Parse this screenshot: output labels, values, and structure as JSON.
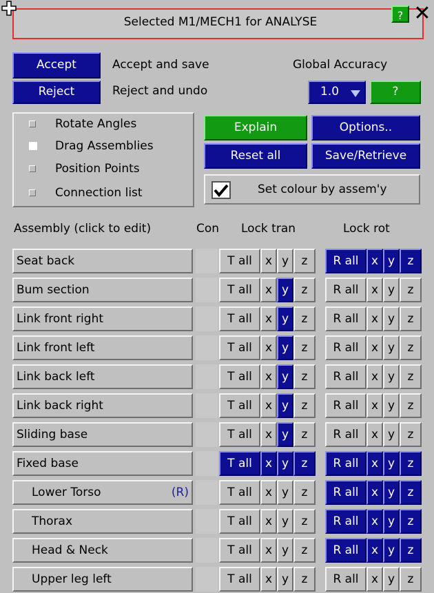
{
  "title": "Selected M1/MECH1 for ANALYSE",
  "help_label": "?",
  "close_label": "✕",
  "accept": {
    "button": "Accept",
    "desc": "Accept and save"
  },
  "reject": {
    "button": "Reject",
    "desc": "Reject and undo"
  },
  "accuracy": {
    "label": "Global Accuracy",
    "value": "1.0",
    "help": "?"
  },
  "options": [
    {
      "label": "Rotate Angles",
      "state": "off"
    },
    {
      "label": "Drag Assemblies",
      "state": "white"
    },
    {
      "label": "Position Points",
      "state": "off"
    },
    {
      "label": "Connection list",
      "state": "off"
    }
  ],
  "buttons": {
    "explain": "Explain",
    "options": "Options..",
    "reset": "Reset all",
    "save": "Save/Retrieve"
  },
  "colour": {
    "label": "Set colour by assem'y",
    "checked": true
  },
  "headers": {
    "assembly": "Assembly (click to edit)",
    "con": "Con",
    "lock_tran": "Lock tran",
    "lock_rot": "Lock rot"
  },
  "lock_labels": {
    "t_all": "T all",
    "r_all": "R all",
    "x": "x",
    "y": "y",
    "z": "z"
  },
  "colors": {
    "navy": "#0e0e92",
    "green": "#129a12",
    "panel": "#c0c0c0",
    "title_border": "#e03030"
  },
  "rows": [
    {
      "name": "Seat back",
      "flag": "",
      "sub": false,
      "tran": [
        false,
        false,
        false,
        false
      ],
      "rot": [
        true,
        true,
        true,
        true
      ]
    },
    {
      "name": "Bum section",
      "flag": "",
      "sub": false,
      "tran": [
        false,
        false,
        true,
        false
      ],
      "rot": [
        false,
        false,
        false,
        false
      ]
    },
    {
      "name": "Link front right",
      "flag": "",
      "sub": false,
      "tran": [
        false,
        false,
        true,
        false
      ],
      "rot": [
        false,
        false,
        false,
        false
      ]
    },
    {
      "name": "Link front left",
      "flag": "",
      "sub": false,
      "tran": [
        false,
        false,
        true,
        false
      ],
      "rot": [
        false,
        false,
        false,
        false
      ]
    },
    {
      "name": "Link back left",
      "flag": "",
      "sub": false,
      "tran": [
        false,
        false,
        true,
        false
      ],
      "rot": [
        false,
        false,
        false,
        false
      ]
    },
    {
      "name": "Link back right",
      "flag": "",
      "sub": false,
      "tran": [
        false,
        false,
        true,
        false
      ],
      "rot": [
        false,
        false,
        false,
        false
      ]
    },
    {
      "name": "Sliding base",
      "flag": "",
      "sub": false,
      "tran": [
        false,
        false,
        true,
        false
      ],
      "rot": [
        false,
        false,
        false,
        false
      ]
    },
    {
      "name": "Fixed base",
      "flag": "",
      "sub": false,
      "tran": [
        true,
        true,
        true,
        true
      ],
      "rot": [
        true,
        true,
        true,
        true
      ]
    },
    {
      "name": "Lower Torso",
      "flag": "(R)",
      "sub": true,
      "tran": [
        false,
        false,
        false,
        false
      ],
      "rot": [
        true,
        true,
        true,
        true
      ]
    },
    {
      "name": "Thorax",
      "flag": "",
      "sub": true,
      "tran": [
        false,
        false,
        false,
        false
      ],
      "rot": [
        true,
        true,
        true,
        true
      ]
    },
    {
      "name": "Head & Neck",
      "flag": "",
      "sub": true,
      "tran": [
        false,
        false,
        false,
        false
      ],
      "rot": [
        true,
        true,
        true,
        true
      ]
    },
    {
      "name": "Upper leg left",
      "flag": "",
      "sub": true,
      "tran": [
        false,
        false,
        false,
        false
      ],
      "rot": [
        false,
        false,
        false,
        false
      ]
    }
  ]
}
